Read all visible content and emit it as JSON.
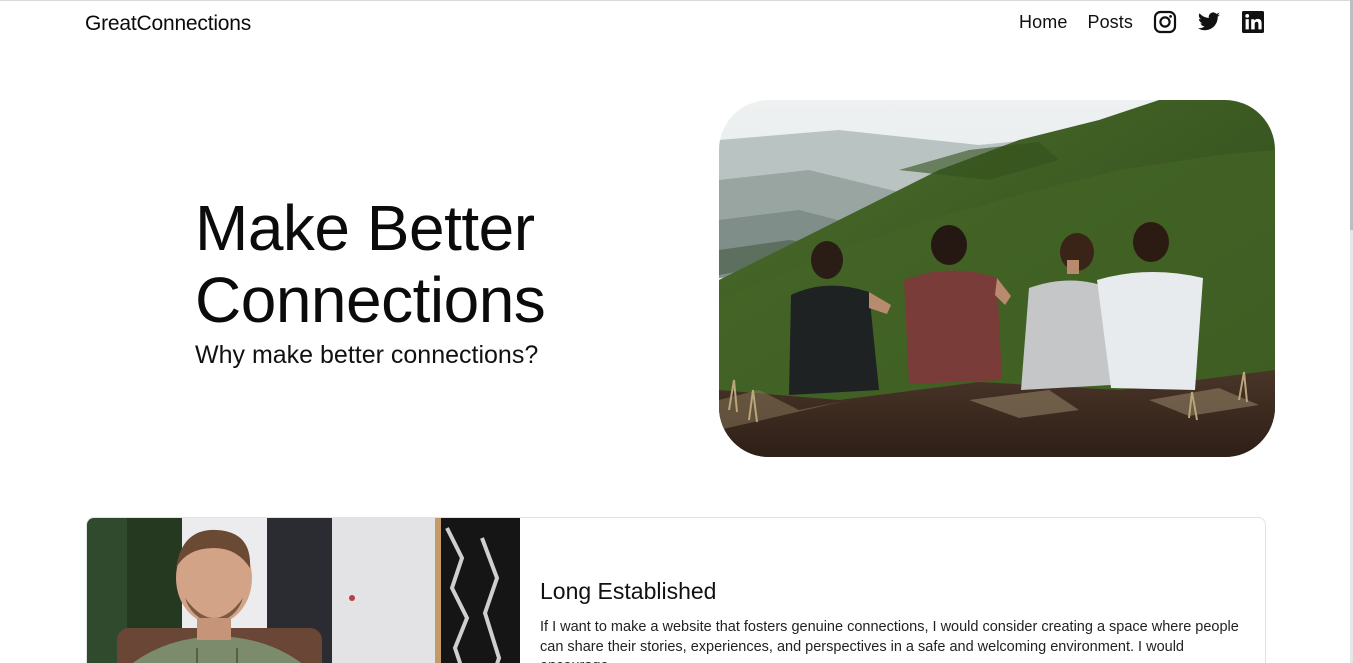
{
  "header": {
    "brand": "GreatConnections",
    "nav": [
      {
        "label": "Home"
      },
      {
        "label": "Posts"
      }
    ],
    "social_icons": [
      "instagram-icon",
      "twitter-icon",
      "linkedin-icon"
    ]
  },
  "hero": {
    "title": "Make Better Connections",
    "subtitle": "Why make better connections?",
    "image": "four friends sitting on a green mountain ridge"
  },
  "card": {
    "image": "smiling bearded man in plaid shirt",
    "title": "Long Established",
    "text": "If I want to make a website that fosters genuine connections, I would consider creating a space where people can share their stories, experiences, and perspectives in a safe and welcoming environment. I would encourage"
  },
  "colors": {
    "text": "#0b0b0b",
    "background": "#ffffff",
    "card_border": "#e2e2e2"
  }
}
